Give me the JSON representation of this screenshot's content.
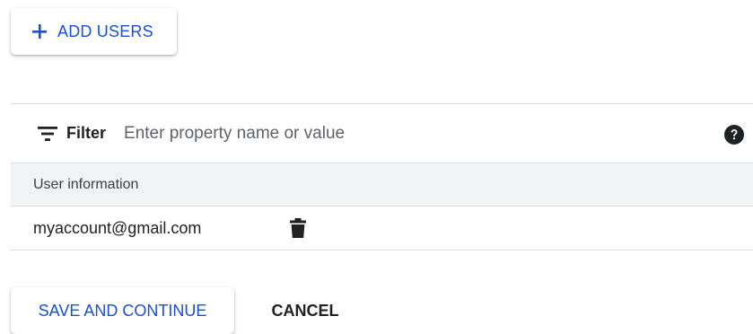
{
  "toolbar": {
    "add_users_label": "ADD USERS",
    "add_users_icon": "plus-icon"
  },
  "filter": {
    "label": "Filter",
    "icon": "filter-list-icon",
    "placeholder": "Enter property name or value",
    "value": "",
    "help_icon": "help-circle-icon"
  },
  "table": {
    "columns": [
      "User information"
    ],
    "rows": [
      {
        "email": "myaccount@gmail.com",
        "action_icon": "trash-icon"
      }
    ]
  },
  "actions": {
    "save_label": "SAVE AND CONTINUE",
    "cancel_label": "CANCEL"
  },
  "colors": {
    "accent": "#1a4fd6",
    "text": "#202124",
    "header_bg": "#f1f3f4",
    "divider": "#dadce0"
  }
}
